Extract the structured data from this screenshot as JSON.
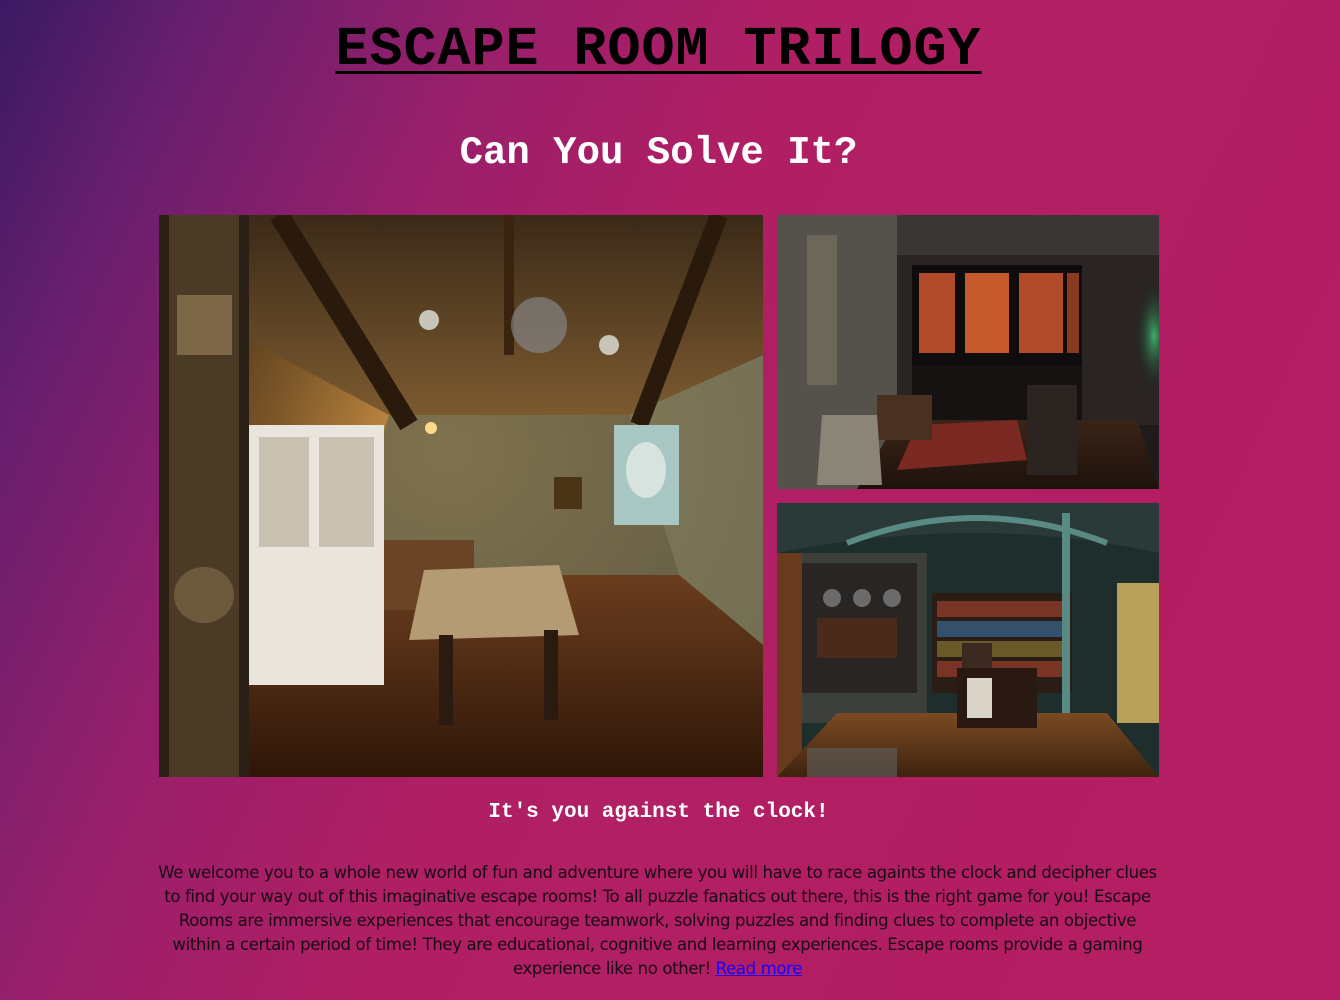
{
  "header": {
    "title": "ESCAPE ROOM TRILOGY",
    "subtitle": "Can You Solve It?"
  },
  "gallery": {
    "images": [
      {
        "name": "escape-room-photo-1"
      },
      {
        "name": "escape-room-photo-2"
      },
      {
        "name": "escape-room-photo-3"
      }
    ]
  },
  "main": {
    "tagline": "It's you against the clock!",
    "intro_text": "We welcome you to a whole new world of fun and adventure where you will have to race againts the clock and decipher clues to find your way out of this imaginative escape rooms! To all puzzle fanatics out there, this is the right game for you! Escape Rooms are immersive experiences that encourage teamwork, solving puzzles and finding clues to complete an objective within a certain period of time! They are educational, cognitive and learning experiences. Escape rooms provide a gaming experience like no other!",
    "read_more_label": "Read more"
  },
  "colors": {
    "background_start": "#3a1a63",
    "background_end": "#b51e62",
    "link": "#1a00ff"
  }
}
